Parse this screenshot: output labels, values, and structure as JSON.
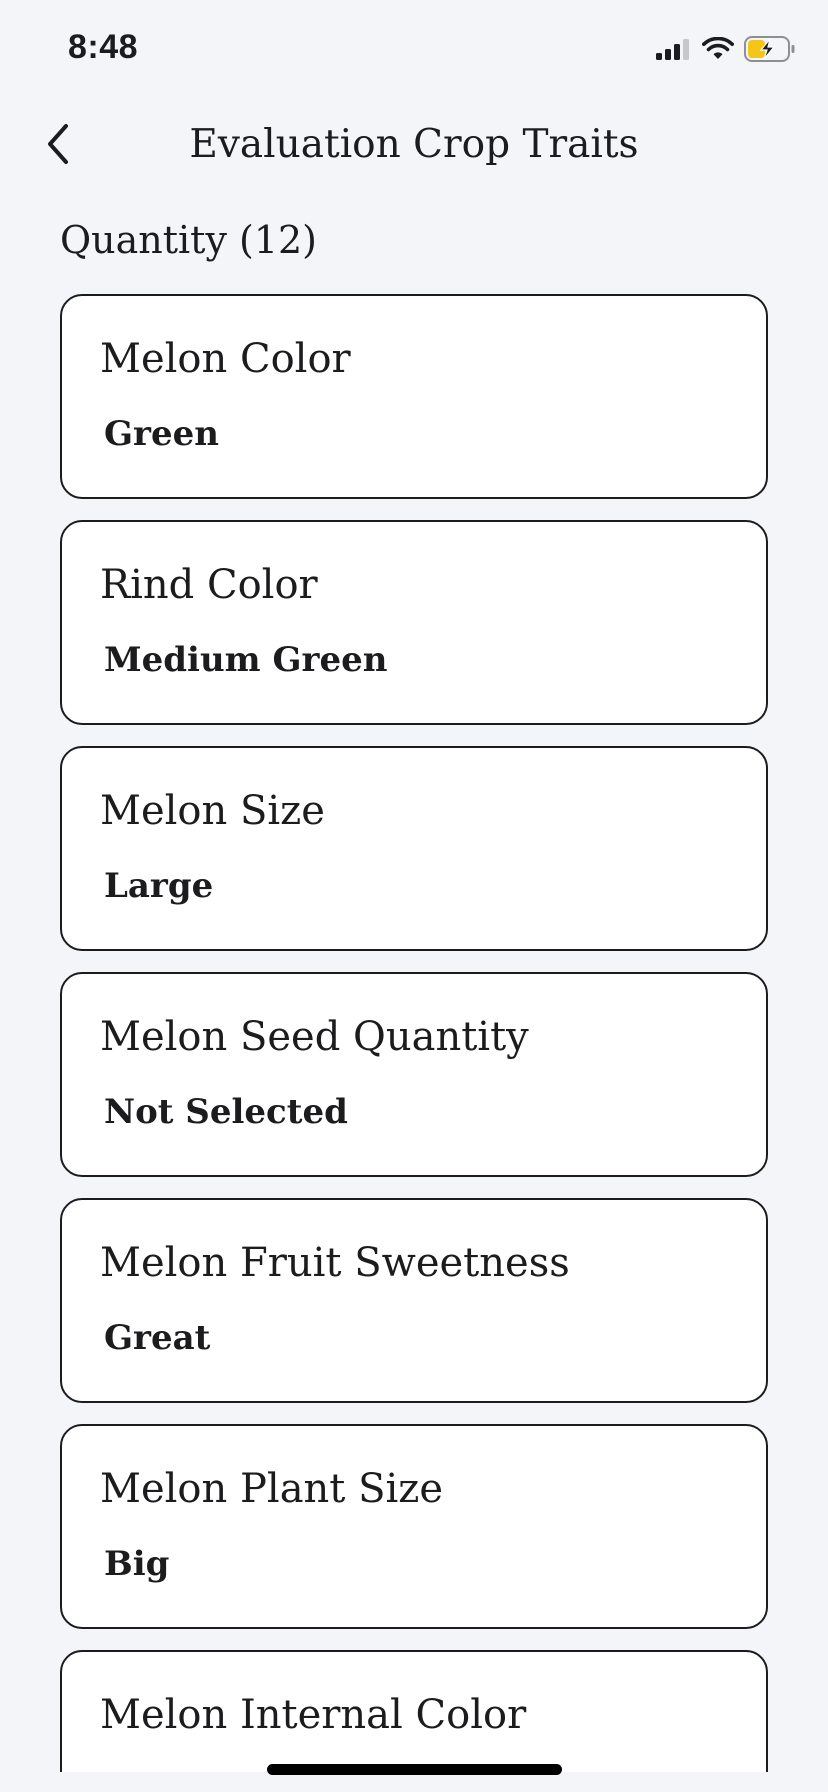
{
  "status_bar": {
    "time": "8:48",
    "icons": [
      "signal-icon",
      "wifi-icon",
      "battery-charging-icon"
    ]
  },
  "nav": {
    "back_icon": "chevron-left-icon",
    "title": "Evaluation Crop Traits"
  },
  "section": {
    "title": "Quantity (12)"
  },
  "traits": [
    {
      "label": "Melon Color",
      "value": "Green"
    },
    {
      "label": "Rind Color",
      "value": "Medium Green"
    },
    {
      "label": "Melon Size",
      "value": "Large"
    },
    {
      "label": "Melon Seed Quantity",
      "value": "Not Selected"
    },
    {
      "label": "Melon Fruit Sweetness",
      "value": "Great"
    },
    {
      "label": "Melon Plant Size",
      "value": "Big"
    },
    {
      "label": "Melon Internal Color",
      "value": ""
    }
  ],
  "colors": {
    "background": "#f4f5f9",
    "card_background": "#ffffff",
    "card_border": "#1c1c1e",
    "battery_fill": "#f5c518"
  }
}
